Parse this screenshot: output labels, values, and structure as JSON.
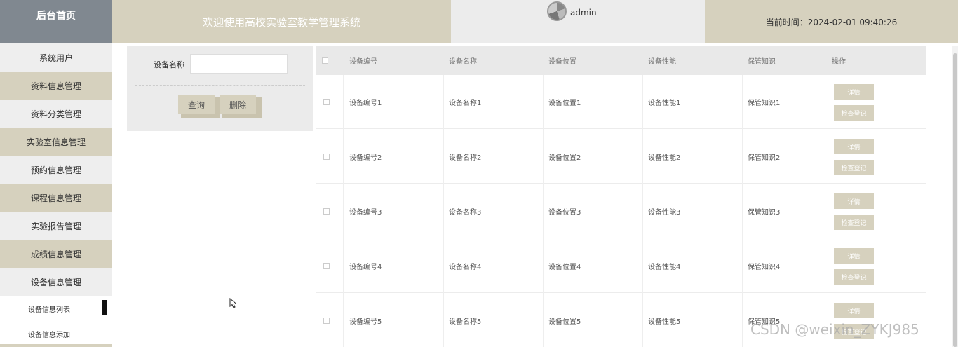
{
  "header": {
    "brand": "后台首页",
    "title": "欢迎使用高校实验室教学管理系统",
    "username": "admin",
    "time": "当前时间：2024-02-01 09:40:26"
  },
  "sidebar": {
    "items": [
      {
        "label": "系统用户",
        "style": "gray"
      },
      {
        "label": "资料信息管理",
        "style": "tan"
      },
      {
        "label": "资料分类管理",
        "style": "gray"
      },
      {
        "label": "实验室信息管理",
        "style": "tan"
      },
      {
        "label": "预约信息管理",
        "style": "gray"
      },
      {
        "label": "课程信息管理",
        "style": "tan"
      },
      {
        "label": "实验报告管理",
        "style": "gray"
      },
      {
        "label": "成绩信息管理",
        "style": "tan"
      },
      {
        "label": "设备信息管理",
        "style": "gray"
      }
    ],
    "subitems": [
      {
        "label": "设备信息列表",
        "active": true
      },
      {
        "label": "设备信息添加",
        "active": false
      }
    ]
  },
  "search": {
    "label": "设备名称",
    "value": "",
    "query_button": "查询",
    "delete_button": "删除"
  },
  "table": {
    "columns": [
      "设备编号",
      "设备名称",
      "设备位置",
      "设备性能",
      "保管知识",
      "操作"
    ],
    "rows": [
      {
        "code": "设备编号1",
        "name": "设备名称1",
        "location": "设备位置1",
        "performance": "设备性能1",
        "knowledge": "保管知识1"
      },
      {
        "code": "设备编号2",
        "name": "设备名称2",
        "location": "设备位置2",
        "performance": "设备性能2",
        "knowledge": "保管知识2"
      },
      {
        "code": "设备编号3",
        "name": "设备名称3",
        "location": "设备位置3",
        "performance": "设备性能3",
        "knowledge": "保管知识3"
      },
      {
        "code": "设备编号4",
        "name": "设备名称4",
        "location": "设备位置4",
        "performance": "设备性能4",
        "knowledge": "保管知识4"
      },
      {
        "code": "设备编号5",
        "name": "设备名称5",
        "location": "设备位置5",
        "performance": "设备性能5",
        "knowledge": "保管知识5"
      }
    ],
    "detail_button": "详情",
    "check_button": "检查登记"
  },
  "watermark": "CSDN @weixin_ZYKJ985",
  "colors": {
    "brand_bg": "#808890",
    "accent_tan": "#d6d1be",
    "light_gray": "#eeeeee"
  }
}
